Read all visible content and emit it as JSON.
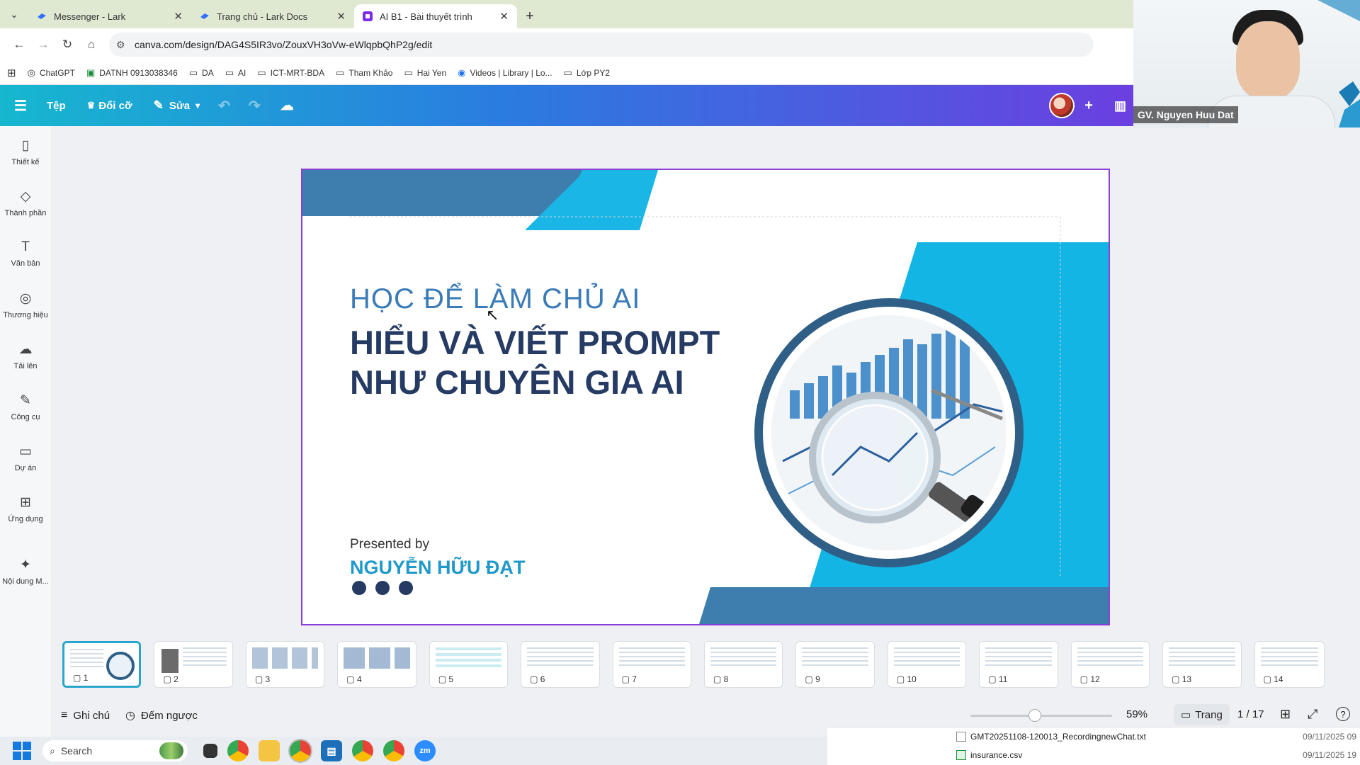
{
  "browser": {
    "tabs": [
      {
        "title": "Messenger - Lark",
        "favicon_color": "#3370ff"
      },
      {
        "title": "Trang chủ - Lark Docs",
        "favicon_color": "#3370ff"
      },
      {
        "title": "AI B1 - Bài thuyết trình",
        "favicon_color": "#7d2ae8"
      }
    ],
    "url": "canva.com/design/DAG4S5IR3vo/ZouxVH3oVw-eWlqpbQhP2g/edit",
    "bookmarks": [
      {
        "label": "ChatGPT",
        "icon": "openai-icon"
      },
      {
        "label": "DATNH 0913038346",
        "icon": "sheets-icon"
      },
      {
        "label": "DA",
        "icon": "folder-icon"
      },
      {
        "label": "AI",
        "icon": "folder-icon"
      },
      {
        "label": "ICT-MRT-BDA",
        "icon": "folder-icon"
      },
      {
        "label": "Tham Khảo",
        "icon": "folder-icon"
      },
      {
        "label": "Hai Yen",
        "icon": "folder-icon"
      },
      {
        "label": "Videos | Library | Lo...",
        "icon": "video-icon"
      },
      {
        "label": "Lớp PY2",
        "icon": "folder-icon"
      }
    ]
  },
  "editor": {
    "file_label": "Tệp",
    "resize_label": "Đổi cỡ",
    "edit_label": "Sửa"
  },
  "video": {
    "name": "GV. Nguyen Huu Dat"
  },
  "sidebar": [
    {
      "label": "Thiết kế",
      "icon": "design-icon",
      "glyph": "▯"
    },
    {
      "label": "Thành phần",
      "icon": "elements-icon",
      "glyph": "◇"
    },
    {
      "label": "Văn bản",
      "icon": "text-icon",
      "glyph": "T"
    },
    {
      "label": "Thương hiệu",
      "icon": "brand-icon",
      "glyph": "◎"
    },
    {
      "label": "Tải lên",
      "icon": "upload-icon",
      "glyph": "☁"
    },
    {
      "label": "Công cụ",
      "icon": "draw-icon",
      "glyph": "✎"
    },
    {
      "label": "Dự án",
      "icon": "folder-icon",
      "glyph": "▭"
    },
    {
      "label": "Ứng dụng",
      "icon": "apps-icon",
      "glyph": "⊞"
    },
    {
      "label": "Nội dung M...",
      "icon": "magic-media-icon",
      "glyph": "✦"
    }
  ],
  "slide": {
    "subtitle": "HỌC ĐỂ LÀM CHỦ AI",
    "title_line1": "HIỂU VÀ VIẾT PROMPT",
    "title_line2": "NHƯ CHUYÊN GIA AI",
    "presented_by": "Presented by",
    "author": "NGUYỄN HỮU ĐẠT"
  },
  "pages": [
    "1",
    "2",
    "3",
    "4",
    "5",
    "6",
    "7",
    "8",
    "9",
    "10",
    "11",
    "12",
    "13",
    "14"
  ],
  "bottombar": {
    "notes_label": "Ghi chú",
    "timer_label": "Đếm ngược",
    "zoom": "59%",
    "zoom_fraction": 0.59,
    "page_view_label": "Trang",
    "page_counter": "1 / 17"
  },
  "taskbar": {
    "search_placeholder": "Search"
  },
  "downloads": [
    {
      "name": "GMT20251108-120013_RecordingnewChat.txt",
      "date": "09/11/2025 09"
    },
    {
      "name": "insurance.csv",
      "date": "09/11/2025 19"
    }
  ]
}
